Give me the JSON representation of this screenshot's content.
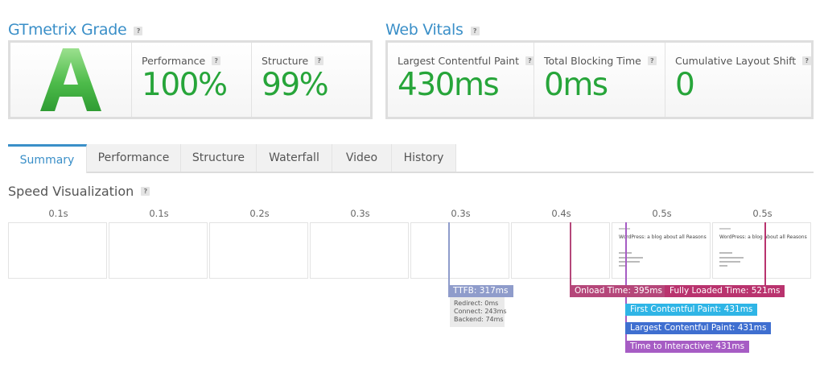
{
  "gtmetrix_grade": {
    "title": "GTmetrix Grade",
    "help": "?",
    "grade": "A",
    "performance": {
      "label": "Performance",
      "value": "100%"
    },
    "structure": {
      "label": "Structure",
      "value": "99%"
    }
  },
  "web_vitals": {
    "title": "Web Vitals",
    "help": "?",
    "lcp": {
      "label": "Largest Contentful Paint",
      "value": "430ms"
    },
    "tbt": {
      "label": "Total Blocking Time",
      "value": "0ms"
    },
    "cls": {
      "label": "Cumulative Layout Shift",
      "value": "0"
    }
  },
  "tabs": [
    "Summary",
    "Performance",
    "Structure",
    "Waterfall",
    "Video",
    "History"
  ],
  "active_tab": "Summary",
  "speed_viz": {
    "title": "Speed Visualization",
    "help": "?",
    "frame_labels": [
      "0.1s",
      "0.1s",
      "0.2s",
      "0.3s",
      "0.3s",
      "0.4s",
      "0.5s",
      "0.5s"
    ],
    "thumbnail_heading": "WordPress: a blog about all Reasons",
    "markers": {
      "ttfb": "TTFB: 317ms",
      "onload": "Onload Time: 395ms",
      "fully_loaded": "Fully Loaded Time: 521ms",
      "fcp": "First Contentful Paint: 431ms",
      "lcp": "Largest Contentful Paint: 431ms",
      "tti": "Time to Interactive: 431ms"
    },
    "ttfb_details": {
      "redirect": "Redirect: 0ms",
      "connect": "Connect: 243ms",
      "backend": "Backend: 74ms"
    }
  },
  "colors": {
    "accent": "#3a8fc8",
    "value_green": "#27a53a",
    "ttfb": "#8f9ccb",
    "onload": "#b5477a",
    "fully_loaded": "#b9336e",
    "fcp": "#2fb5e6",
    "lcp": "#3f6fd0",
    "tti": "#a65cc4"
  }
}
